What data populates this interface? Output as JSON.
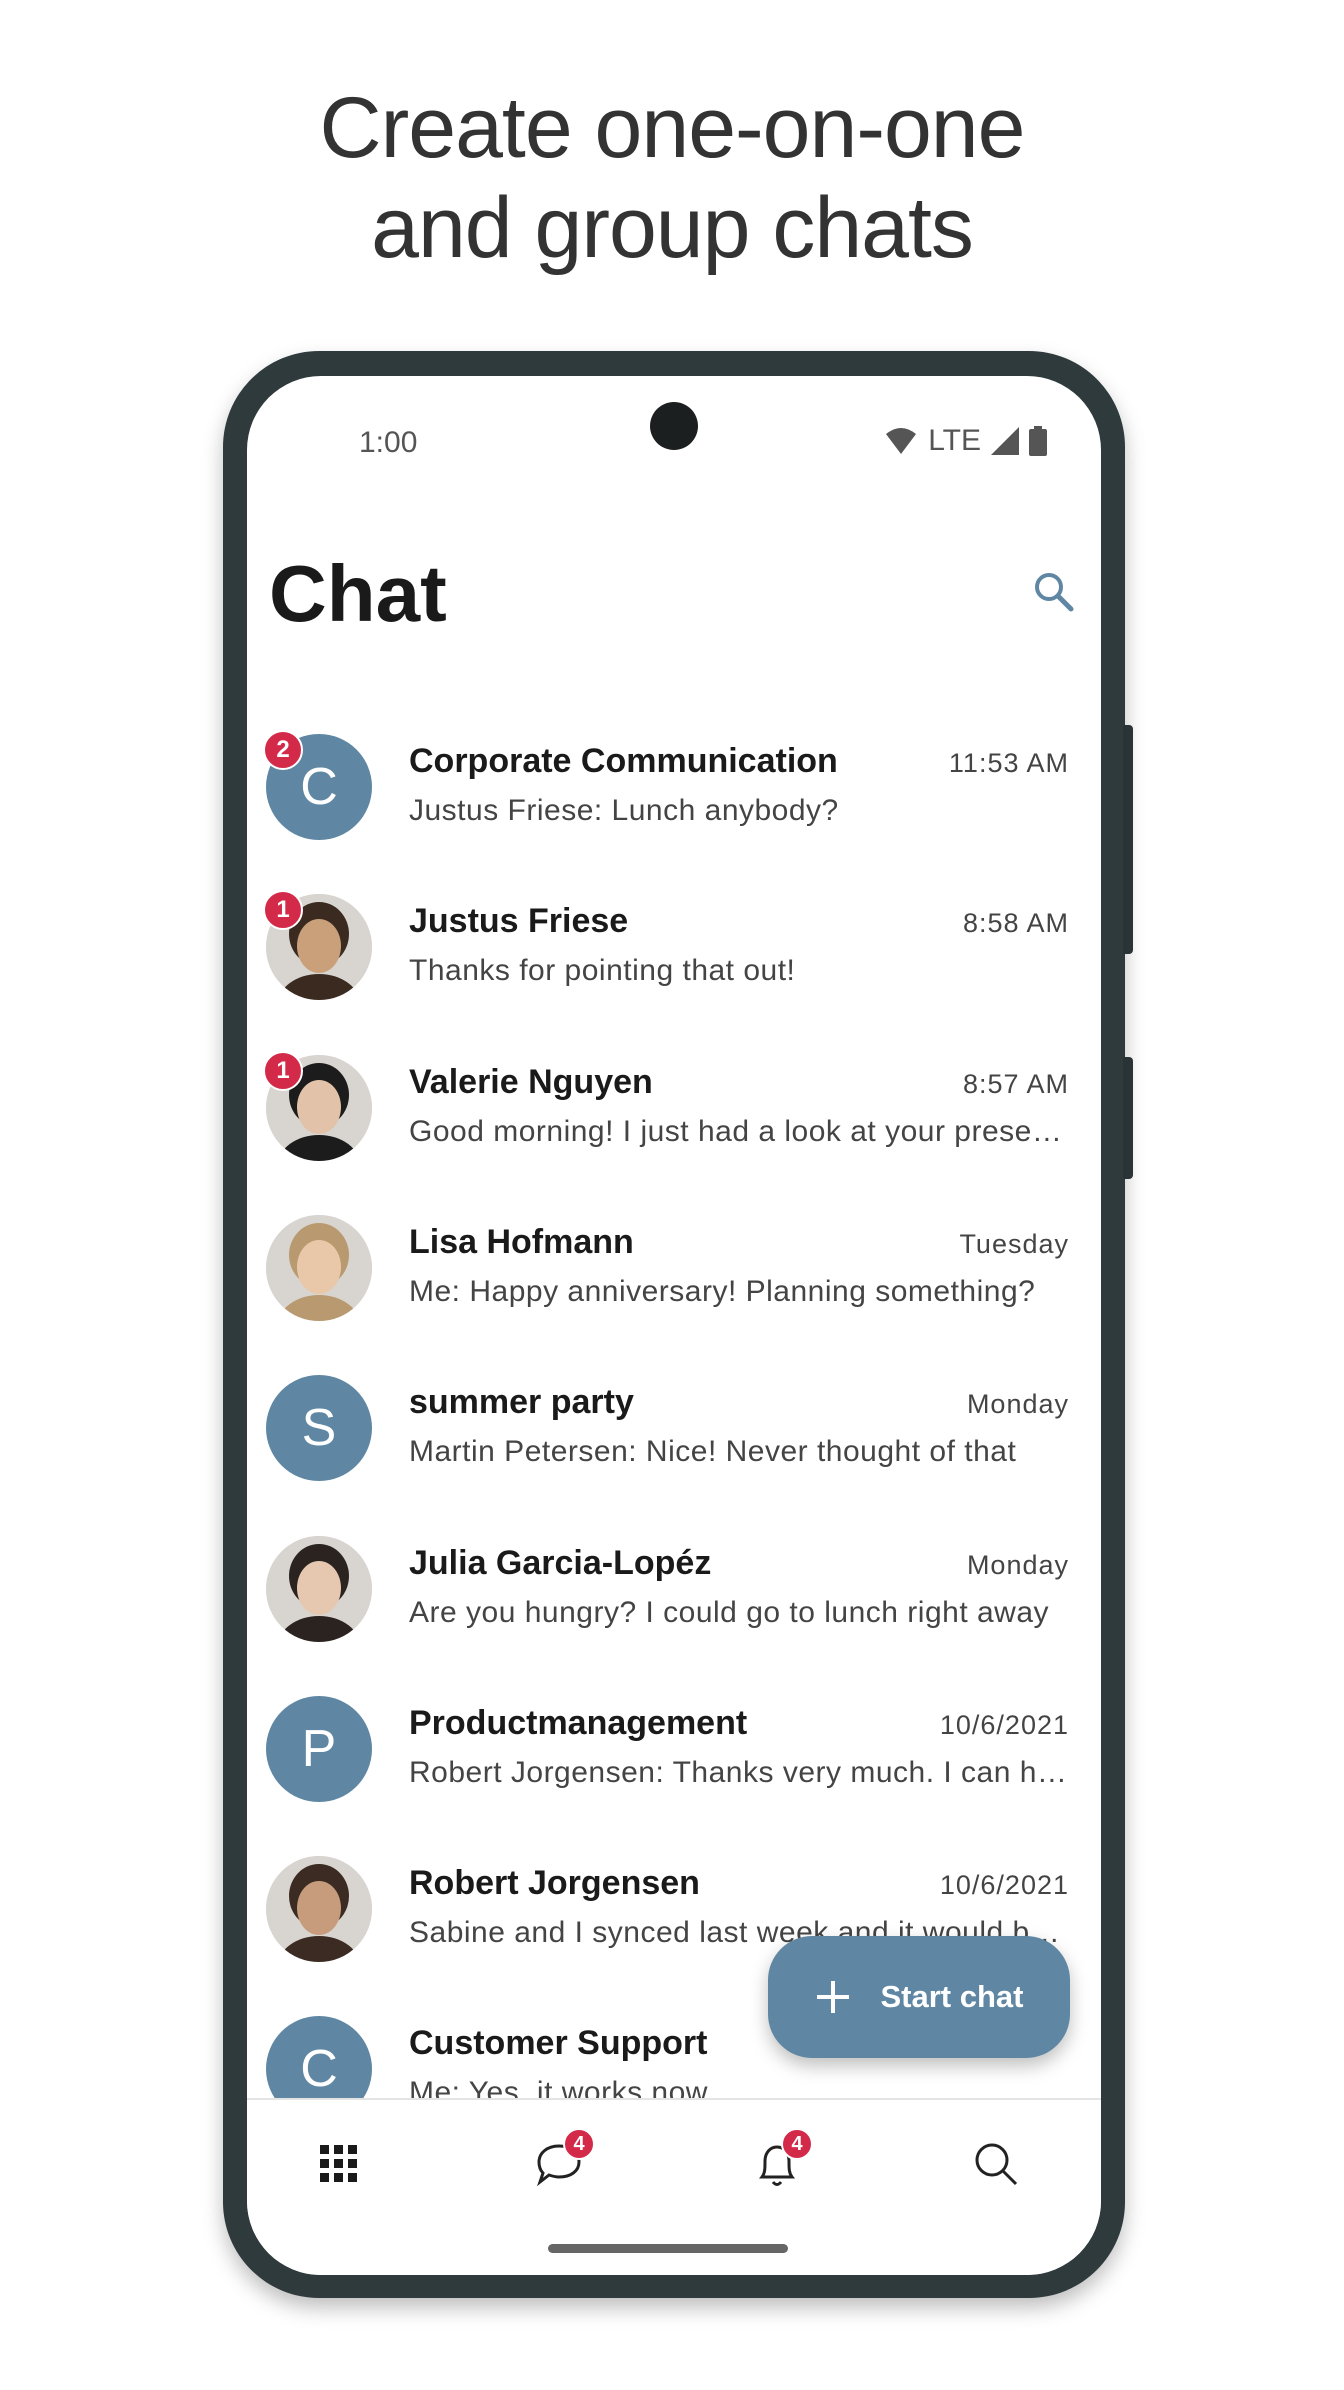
{
  "headline": {
    "line1": "Create one-on-one",
    "line2": "and group chats"
  },
  "status": {
    "time": "1:00",
    "network": "LTE"
  },
  "header": {
    "title": "Chat",
    "search_icon": "search-icon"
  },
  "accent": "#5f87a3",
  "badge_color": "#d42a4a",
  "chats": [
    {
      "name": "Corporate Communication",
      "time": "11:53 AM",
      "preview": "Justus Friese: Lunch anybody?",
      "initial": "C",
      "unread": "2",
      "photo": false
    },
    {
      "name": "Justus Friese",
      "time": "8:58 AM",
      "preview": "Thanks for pointing that out!",
      "initial": "",
      "unread": "1",
      "photo": true
    },
    {
      "name": "Valerie Nguyen",
      "time": "8:57 AM",
      "preview": "Good morning! I just had a look at your presentation",
      "initial": "",
      "unread": "1",
      "photo": true
    },
    {
      "name": "Lisa Hofmann",
      "time": "Tuesday",
      "preview": "Me: Happy anniversary! Planning something?",
      "initial": "",
      "unread": "",
      "photo": true
    },
    {
      "name": "summer party",
      "time": "Monday",
      "preview": "Martin Petersen: Nice! Never thought of that",
      "initial": "S",
      "unread": "",
      "photo": false
    },
    {
      "name": "Julia Garcia-Lopéz",
      "time": "Monday",
      "preview": "Are you hungry? I could go to lunch right away",
      "initial": "",
      "unread": "",
      "photo": true
    },
    {
      "name": "Productmanagement",
      "time": "10/6/2021",
      "preview": "Robert Jorgensen: Thanks very much. I can have a look",
      "initial": "P",
      "unread": "",
      "photo": false
    },
    {
      "name": "Robert Jorgensen",
      "time": "10/6/2021",
      "preview": "Sabine and I synced last week and it would be great",
      "initial": "",
      "unread": "",
      "photo": true
    },
    {
      "name": "Customer Support",
      "time": "",
      "preview": "Me: Yes, it works now",
      "initial": "C",
      "unread": "",
      "photo": false
    }
  ],
  "fab": {
    "label": "Start chat",
    "icon": "plus-icon"
  },
  "nav": [
    {
      "icon": "apps-grid-icon",
      "badge": ""
    },
    {
      "icon": "chat-bubble-icon",
      "badge": "4"
    },
    {
      "icon": "bell-icon",
      "badge": "4"
    },
    {
      "icon": "search-icon",
      "badge": ""
    }
  ]
}
